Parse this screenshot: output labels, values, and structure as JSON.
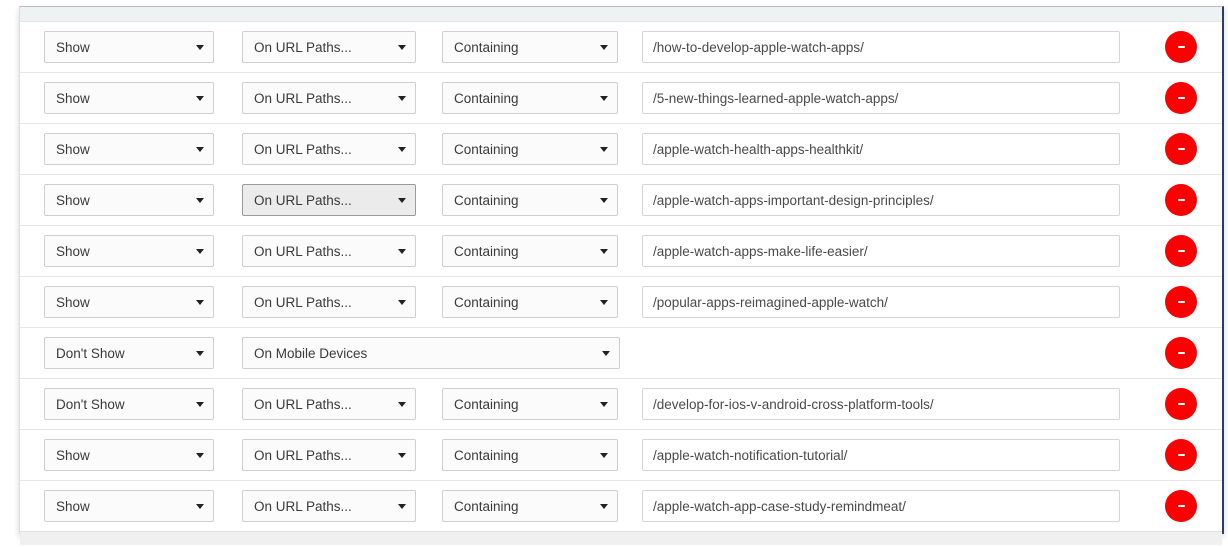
{
  "panel": {
    "header_label": "",
    "footer_label": ""
  },
  "controls": {
    "caret_icon": "chevron-down-icon",
    "remove_icon": "minus-icon",
    "remove_label": "-",
    "url_placeholder": ""
  },
  "options": {
    "action": [
      "Show",
      "Don't Show"
    ],
    "target": [
      "On URL Paths...",
      "On Mobile Devices"
    ],
    "match": [
      "Containing"
    ]
  },
  "rules": [
    {
      "action": "Show",
      "target": "On URL Paths...",
      "match": "Containing",
      "url": "/how-to-develop-apple-watch-apps/",
      "target_wide": false,
      "target_hovered": false
    },
    {
      "action": "Show",
      "target": "On URL Paths...",
      "match": "Containing",
      "url": "/5-new-things-learned-apple-watch-apps/",
      "target_wide": false,
      "target_hovered": false
    },
    {
      "action": "Show",
      "target": "On URL Paths...",
      "match": "Containing",
      "url": "/apple-watch-health-apps-healthkit/",
      "target_wide": false,
      "target_hovered": false
    },
    {
      "action": "Show",
      "target": "On URL Paths...",
      "match": "Containing",
      "url": "/apple-watch-apps-important-design-principles/",
      "target_wide": false,
      "target_hovered": true
    },
    {
      "action": "Show",
      "target": "On URL Paths...",
      "match": "Containing",
      "url": "/apple-watch-apps-make-life-easier/",
      "target_wide": false,
      "target_hovered": false
    },
    {
      "action": "Show",
      "target": "On URL Paths...",
      "match": "Containing",
      "url": "/popular-apps-reimagined-apple-watch/",
      "target_wide": false,
      "target_hovered": false
    },
    {
      "action": "Don't Show",
      "target": "On Mobile Devices",
      "match": null,
      "url": null,
      "target_wide": true,
      "target_hovered": false
    },
    {
      "action": "Don't Show",
      "target": "On URL Paths...",
      "match": "Containing",
      "url": "/develop-for-ios-v-android-cross-platform-tools/",
      "target_wide": false,
      "target_hovered": false
    },
    {
      "action": "Show",
      "target": "On URL Paths...",
      "match": "Containing",
      "url": "/apple-watch-notification-tutorial/",
      "target_wide": false,
      "target_hovered": false
    },
    {
      "action": "Show",
      "target": "On URL Paths...",
      "match": "Containing",
      "url": "/apple-watch-app-case-study-remindmeat/",
      "target_wide": false,
      "target_hovered": false
    }
  ]
}
